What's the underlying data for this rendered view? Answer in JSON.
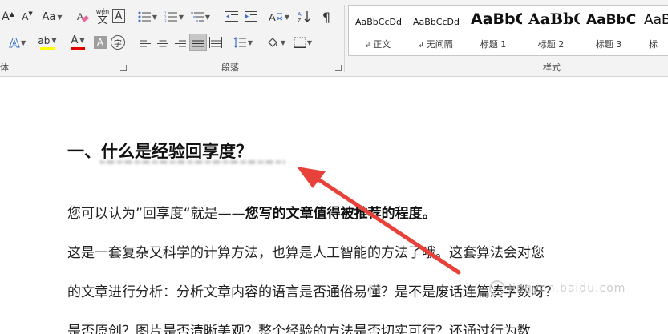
{
  "ribbon": {
    "font_group_label": "体",
    "paragraph_group_label": "段落",
    "styles_group_label": "样式",
    "font": {
      "grow_label": "A",
      "shrink_label": "A",
      "case_label": "Aa",
      "clear_format_icon": "eraser-icon",
      "phonetic_label": "wén",
      "phonetic_char": "文",
      "border_char_label": "A",
      "text_effect_label": "A",
      "highlight_label": "ab",
      "font_color_label": "A",
      "shading_label": "A",
      "enclose_label": "字",
      "highlight_color": "#ffff00",
      "font_color": "#e00000"
    },
    "styles": [
      {
        "sample": "AaBbCcDd",
        "name": "正文"
      },
      {
        "sample": "AaBbCcDd",
        "name": "无间隔"
      },
      {
        "sample": "AaBbC",
        "name": "标题 1"
      },
      {
        "sample": "AaBbC",
        "name": "标题 2"
      },
      {
        "sample": "AaBbC",
        "name": "标题 3"
      },
      {
        "sample": "AaB",
        "name": "标"
      }
    ]
  },
  "document": {
    "heading": "一、什么是经验回享度？",
    "p1_normal": "您可以认为”回享度“就是——",
    "p1_bold": "您写的文章值得被推荐的程度。",
    "p2": "这是一套复杂又科学的计算方法，也算是人工智能的方法了哦。这套算法会对您",
    "p3": "的文章进行分析：分析文章内容的语言是否通俗易懂？是不是废话连篇凑字数呀？",
    "p4": "是否原创？图片是否清晰美观？整个经验的方法是否切实可行？还通过行为数"
  },
  "watermark": "Jingyan.baidu.com",
  "accent_arrow_color": "#e8413a"
}
